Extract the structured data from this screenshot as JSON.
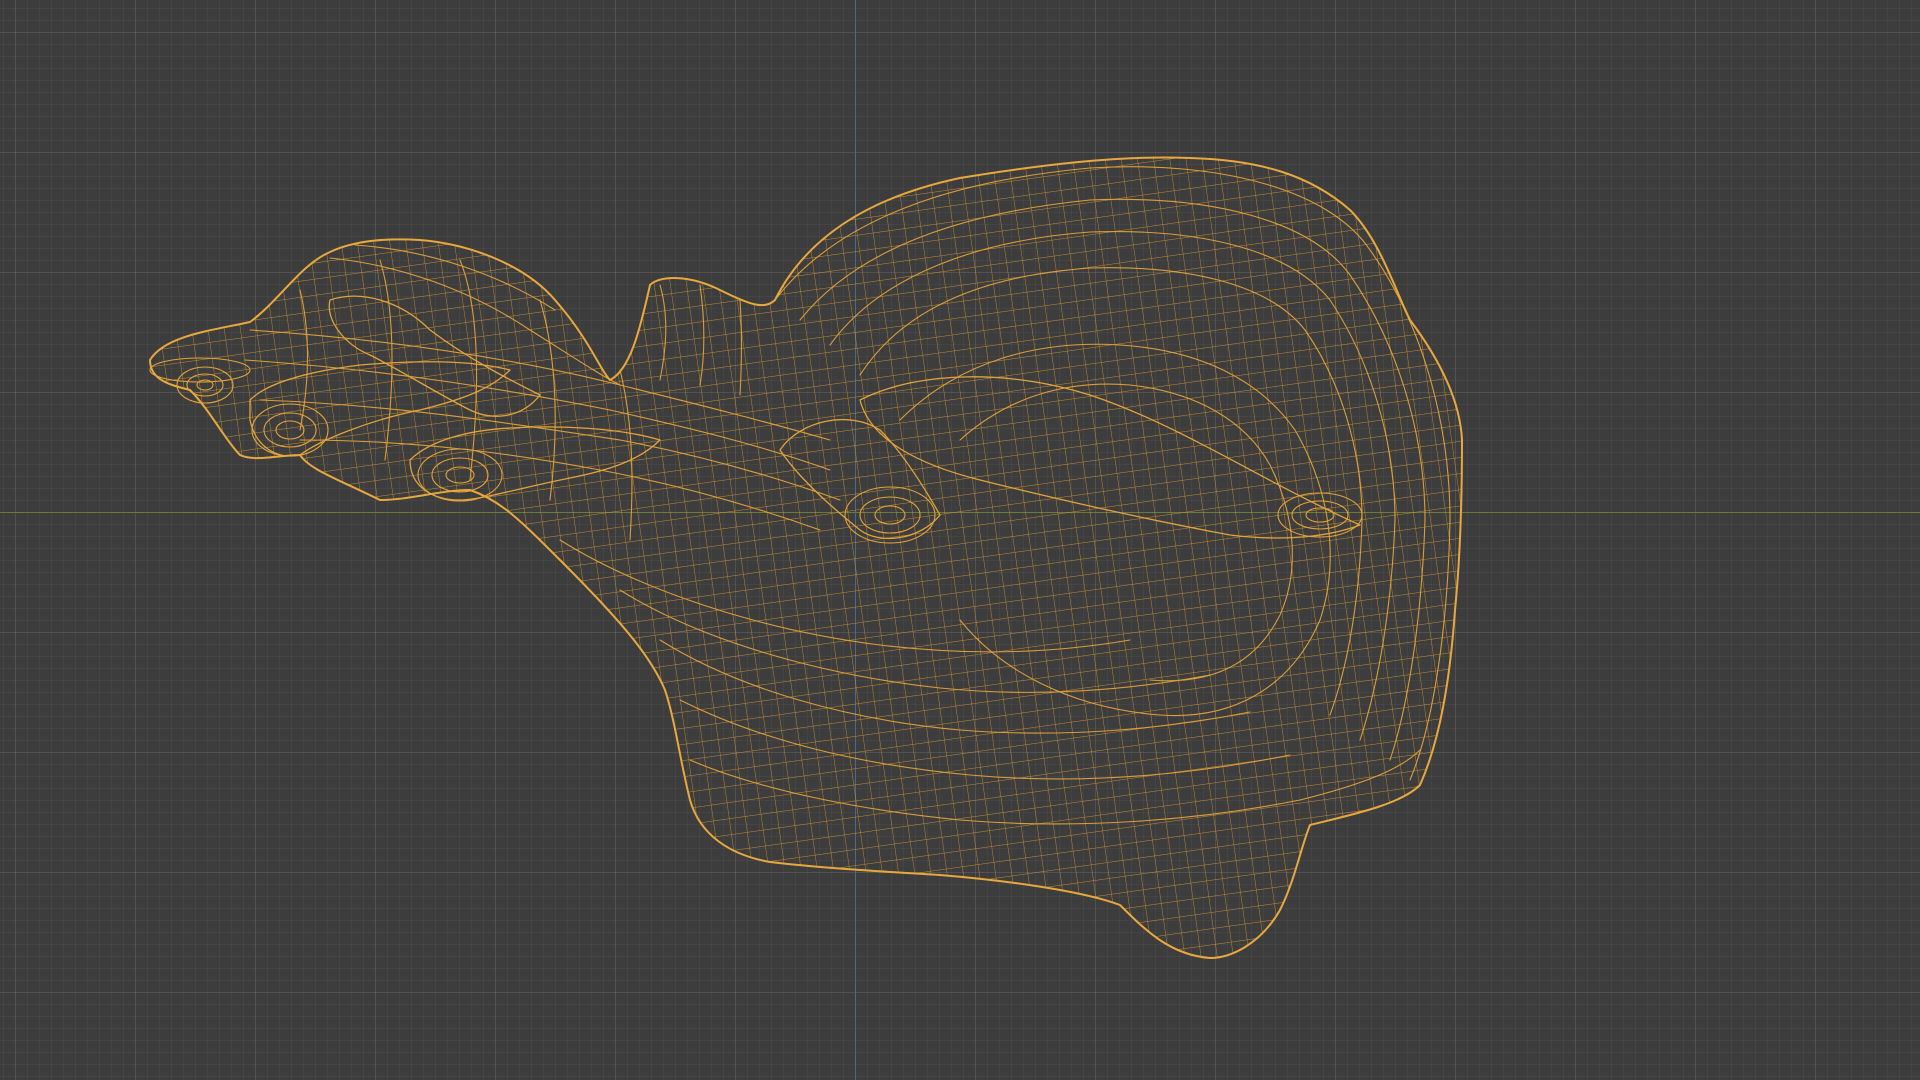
{
  "viewport": {
    "background_color": "#3d3d3d",
    "grid_color": "#4a4a4a",
    "x_axis_color": "#6a7a3c",
    "y_axis_color": "#4a6a8c"
  },
  "mesh": {
    "display_mode": "wireframe",
    "wire_color": "#e3a33a",
    "object": "sculpted-organic-shell-mesh"
  }
}
